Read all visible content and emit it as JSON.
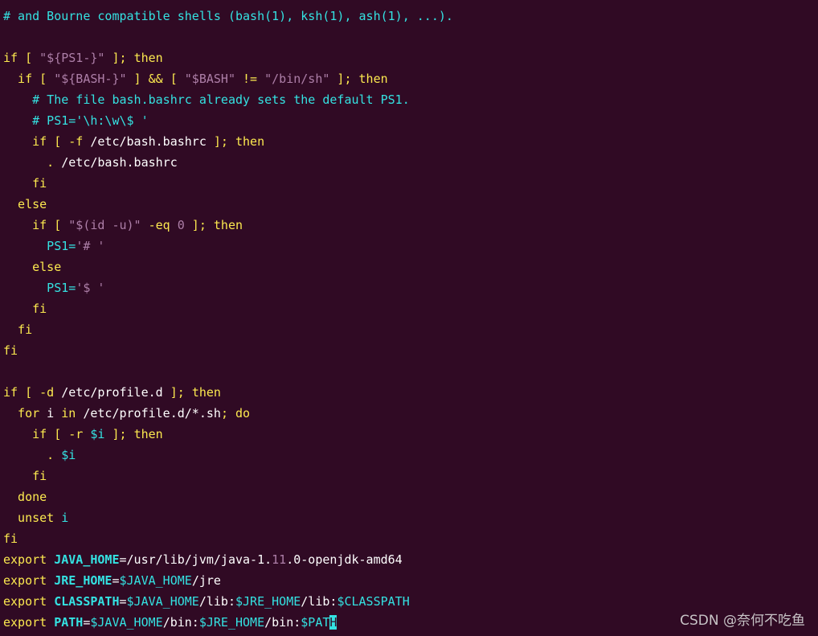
{
  "terminal": {
    "colors": {
      "background": "#300a24",
      "comment": "#34e2e2",
      "keyword": "#fce94f",
      "string": "#ad7fa8",
      "variable": "#34e2e2",
      "plain": "#ffffff"
    },
    "lines": [
      [
        {
          "t": "# and Bourne compatible shells (bash(1), ksh(1), ash(1), ...).",
          "c": "comment"
        }
      ],
      [],
      [
        {
          "t": "if",
          "c": "keyword"
        },
        {
          "t": " [ ",
          "c": "keyword"
        },
        {
          "t": "\"${PS1-}\"",
          "c": "string"
        },
        {
          "t": " ]; ",
          "c": "keyword"
        },
        {
          "t": "then",
          "c": "keyword"
        }
      ],
      [
        {
          "t": "  if",
          "c": "keyword"
        },
        {
          "t": " [ ",
          "c": "keyword"
        },
        {
          "t": "\"${BASH-}\"",
          "c": "string"
        },
        {
          "t": " ] && [ ",
          "c": "keyword"
        },
        {
          "t": "\"$BASH\"",
          "c": "string"
        },
        {
          "t": " != ",
          "c": "keyword"
        },
        {
          "t": "\"/bin/sh\"",
          "c": "string"
        },
        {
          "t": " ]; ",
          "c": "keyword"
        },
        {
          "t": "then",
          "c": "keyword"
        }
      ],
      [
        {
          "t": "    # The file bash.bashrc already sets the default PS1.",
          "c": "comment"
        }
      ],
      [
        {
          "t": "    # PS1='\\h:\\w\\$ '",
          "c": "comment"
        }
      ],
      [
        {
          "t": "    if",
          "c": "keyword"
        },
        {
          "t": " [ ",
          "c": "keyword"
        },
        {
          "t": "-f",
          "c": "keyword"
        },
        {
          "t": " /etc/bash.bashrc",
          "c": "plain"
        },
        {
          "t": " ]; ",
          "c": "keyword"
        },
        {
          "t": "then",
          "c": "keyword"
        }
      ],
      [
        {
          "t": "      . ",
          "c": "keyword"
        },
        {
          "t": "/etc/bash.bashrc",
          "c": "plain"
        }
      ],
      [
        {
          "t": "    fi",
          "c": "keyword"
        }
      ],
      [
        {
          "t": "  else",
          "c": "keyword"
        }
      ],
      [
        {
          "t": "    if",
          "c": "keyword"
        },
        {
          "t": " [ ",
          "c": "keyword"
        },
        {
          "t": "\"$(id -u)\"",
          "c": "string"
        },
        {
          "t": " -eq ",
          "c": "keyword"
        },
        {
          "t": "0",
          "c": "string"
        },
        {
          "t": " ]; ",
          "c": "keyword"
        },
        {
          "t": "then",
          "c": "keyword"
        }
      ],
      [
        {
          "t": "      PS1=",
          "c": "variable"
        },
        {
          "t": "'# '",
          "c": "string"
        }
      ],
      [
        {
          "t": "    else",
          "c": "keyword"
        }
      ],
      [
        {
          "t": "      PS1=",
          "c": "variable"
        },
        {
          "t": "'$ '",
          "c": "string"
        }
      ],
      [
        {
          "t": "    fi",
          "c": "keyword"
        }
      ],
      [
        {
          "t": "  fi",
          "c": "keyword"
        }
      ],
      [
        {
          "t": "fi",
          "c": "keyword"
        }
      ],
      [],
      [
        {
          "t": "if",
          "c": "keyword"
        },
        {
          "t": " [ ",
          "c": "keyword"
        },
        {
          "t": "-d",
          "c": "keyword"
        },
        {
          "t": " /etc/profile.d",
          "c": "plain"
        },
        {
          "t": " ]; ",
          "c": "keyword"
        },
        {
          "t": "then",
          "c": "keyword"
        }
      ],
      [
        {
          "t": "  for",
          "c": "keyword"
        },
        {
          "t": " i ",
          "c": "plain"
        },
        {
          "t": "in",
          "c": "keyword"
        },
        {
          "t": " /etc/profile.d/*.sh",
          "c": "plain"
        },
        {
          "t": "; ",
          "c": "keyword"
        },
        {
          "t": "do",
          "c": "keyword"
        }
      ],
      [
        {
          "t": "    if",
          "c": "keyword"
        },
        {
          "t": " [ ",
          "c": "keyword"
        },
        {
          "t": "-r",
          "c": "keyword"
        },
        {
          "t": " $i",
          "c": "variable"
        },
        {
          "t": " ]; ",
          "c": "keyword"
        },
        {
          "t": "then",
          "c": "keyword"
        }
      ],
      [
        {
          "t": "      . ",
          "c": "keyword"
        },
        {
          "t": "$i",
          "c": "variable"
        }
      ],
      [
        {
          "t": "    fi",
          "c": "keyword"
        }
      ],
      [
        {
          "t": "  done",
          "c": "keyword"
        }
      ],
      [
        {
          "t": "  unset",
          "c": "keyword"
        },
        {
          "t": " i",
          "c": "variable"
        }
      ],
      [
        {
          "t": "fi",
          "c": "keyword"
        }
      ],
      [
        {
          "t": "export",
          "c": "keyword"
        },
        {
          "t": " JAVA_HOME",
          "c": "variable",
          "b": true
        },
        {
          "t": "=/usr/lib/jvm/java-1.",
          "c": "plain"
        },
        {
          "t": "11",
          "c": "string"
        },
        {
          "t": ".0-openjdk-amd64",
          "c": "plain"
        }
      ],
      [
        {
          "t": "export",
          "c": "keyword"
        },
        {
          "t": " JRE_HOME",
          "c": "variable",
          "b": true
        },
        {
          "t": "=",
          "c": "plain"
        },
        {
          "t": "$JAVA_HOME",
          "c": "variable"
        },
        {
          "t": "/jre",
          "c": "plain"
        }
      ],
      [
        {
          "t": "export",
          "c": "keyword"
        },
        {
          "t": " CLASSPATH",
          "c": "variable",
          "b": true
        },
        {
          "t": "=",
          "c": "plain"
        },
        {
          "t": "$JAVA_HOME",
          "c": "variable"
        },
        {
          "t": "/lib:",
          "c": "plain"
        },
        {
          "t": "$JRE_HOME",
          "c": "variable"
        },
        {
          "t": "/lib:",
          "c": "plain"
        },
        {
          "t": "$CLASSPATH",
          "c": "variable"
        }
      ],
      [
        {
          "t": "export",
          "c": "keyword"
        },
        {
          "t": " PATH",
          "c": "variable",
          "b": true
        },
        {
          "t": "=",
          "c": "plain"
        },
        {
          "t": "$JAVA_HOME",
          "c": "variable"
        },
        {
          "t": "/bin:",
          "c": "plain"
        },
        {
          "t": "$JRE_HOME",
          "c": "variable"
        },
        {
          "t": "/bin:",
          "c": "plain"
        },
        {
          "t": "$PAT",
          "c": "variable"
        },
        {
          "t": "H",
          "c": "cursor"
        }
      ]
    ]
  },
  "watermark": {
    "text": "CSDN @奈何不吃鱼"
  }
}
